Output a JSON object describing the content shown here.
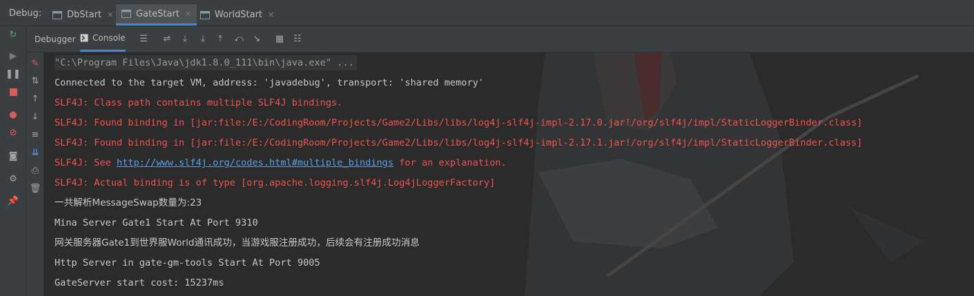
{
  "debug_bar": {
    "label": "Debug:",
    "tabs": [
      {
        "label": "DbStart",
        "active": false
      },
      {
        "label": "GateStart",
        "active": true
      },
      {
        "label": "WorldStart",
        "active": false
      }
    ]
  },
  "toolbar": {
    "debugger_label": "Debugger",
    "console_label": "Console"
  },
  "console": {
    "lines": [
      {
        "kind": "gray",
        "text": "\"C:\\Program Files\\Java\\jdk1.8.0_111\\bin\\java.exe\" ..."
      },
      {
        "kind": "normal",
        "text": "Connected to the target VM, address: 'javadebug', transport: 'shared memory'"
      },
      {
        "kind": "err",
        "text": "SLF4J: Class path contains multiple SLF4J bindings."
      },
      {
        "kind": "err",
        "text": "SLF4J: Found binding in [jar:file:/E:/CodingRoom/Projects/Game2/Libs/libs/log4j-slf4j-impl-2.17.0.jar!/org/slf4j/impl/StaticLoggerBinder.class]"
      },
      {
        "kind": "err",
        "text": "SLF4J: Found binding in [jar:file:/E:/CodingRoom/Projects/Game2/Libs/libs/log4j-slf4j-impl-2.17.1.jar!/org/slf4j/impl/StaticLoggerBinder.class]"
      },
      {
        "kind": "err-link",
        "prefix": "SLF4J: See ",
        "link": "http://www.slf4j.org/codes.html#multiple_bindings",
        "suffix": " for an explanation."
      },
      {
        "kind": "err",
        "text": "SLF4J: Actual binding is of type [org.apache.logging.slf4j.Log4jLoggerFactory]"
      },
      {
        "kind": "normal-cjk",
        "text": "一共解析MessageSwap数量为:23"
      },
      {
        "kind": "normal",
        "text": "Mina Server Gate1 Start At Port 9310"
      },
      {
        "kind": "normal-cjk",
        "text": "网关服务器Gate1到世界服World通讯成功，当游戏服注册成功，后续会有注册成功消息"
      },
      {
        "kind": "normal",
        "text": "Http Server in gate-gm-tools Start At Port 9005"
      },
      {
        "kind": "normal",
        "text": "GateServer start cost: 15237ms"
      }
    ]
  },
  "colors": {
    "error": "#ef5350",
    "link": "#5c9ee6",
    "accent": "#4a88c7",
    "background": "#2b2b2b"
  }
}
